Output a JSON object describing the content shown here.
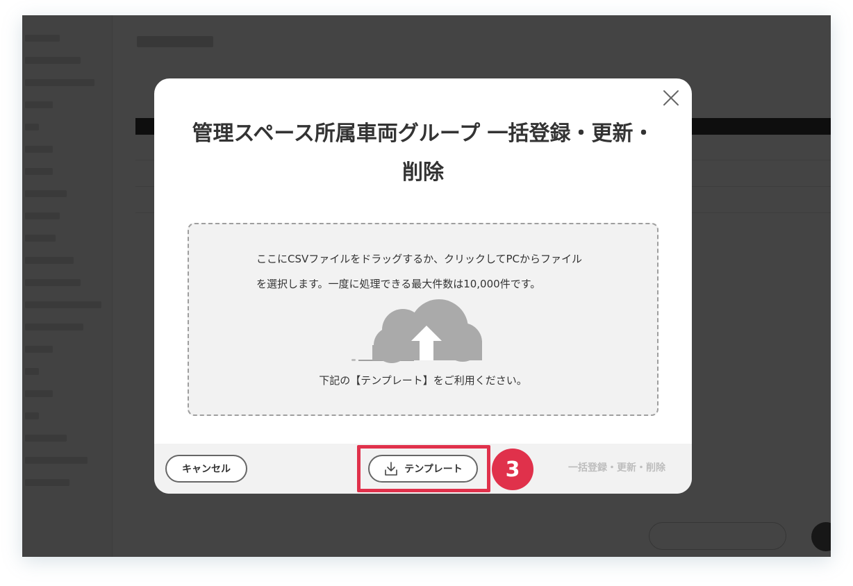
{
  "modal": {
    "title": "管理スペース所属車両グループ 一括登録・更新・削除",
    "dropzone_text": "ここにCSVファイルをドラッグするか、クリックしてPCからファイルを選択します。一度に処理できる最大件数は10,000件です。",
    "dropzone_note": "下記の【テンプレート】をご利用ください。",
    "cancel_label": "キャンセル",
    "template_label": "テンプレート",
    "submit_label": "一括登録・更新・削除",
    "close_icon": "close-icon",
    "upload_icon": "cloud-upload-icon",
    "download_icon": "download-icon"
  },
  "annotation": {
    "step_number": "3",
    "color": "#e0314b"
  }
}
